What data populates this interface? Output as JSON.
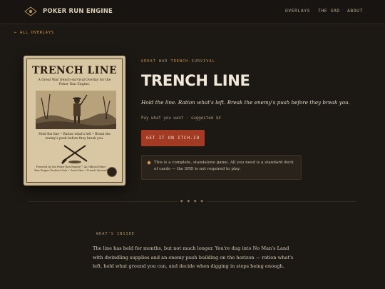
{
  "header": {
    "brand": "POKER RUN ENGINE",
    "nav": {
      "overlays": "OVERLAYS",
      "srd": "THE SRD",
      "about": "ABOUT"
    }
  },
  "back_link": "← ALL OVERLAYS",
  "cover": {
    "title": "TRENCH LINE",
    "subtitle": "A Great War trench-survival Overlay for the Poker Run Engine.",
    "hold_text": "Hold the line • Ration what's left • Break the enemy's push before they break you.",
    "credit": "Powered by the Poker Run Engine™ An Official Poker Run Engine Product Solo • Great War • Trench Survival"
  },
  "game": {
    "eyebrow": "GREAT WAR TRENCH-SURVIVAL",
    "title": "TRENCH LINE",
    "tagline": "Hold the line. Ration what's left. Break the enemy's push before they break you.",
    "price": "Pay what you want · suggested $4",
    "cta": "GET IT ON ITCH.IO",
    "note": "This is a complete, standalone game. All you need is a standard deck of cards — the SRD is not required to play."
  },
  "divider": "◆ ◆ ◆ ◆",
  "section": {
    "label": "WHAT'S INSIDE",
    "body": "The line has held for months, but not much longer. You're dug into No Man's Land with dwindling supplies and an enemy push building on the horizon — ration what's left, hold what ground you can, and decide when digging in stops being enough."
  },
  "colors": {
    "accent": "#a23a24",
    "eyebrow": "#b8925a",
    "background": "#1c1814"
  }
}
